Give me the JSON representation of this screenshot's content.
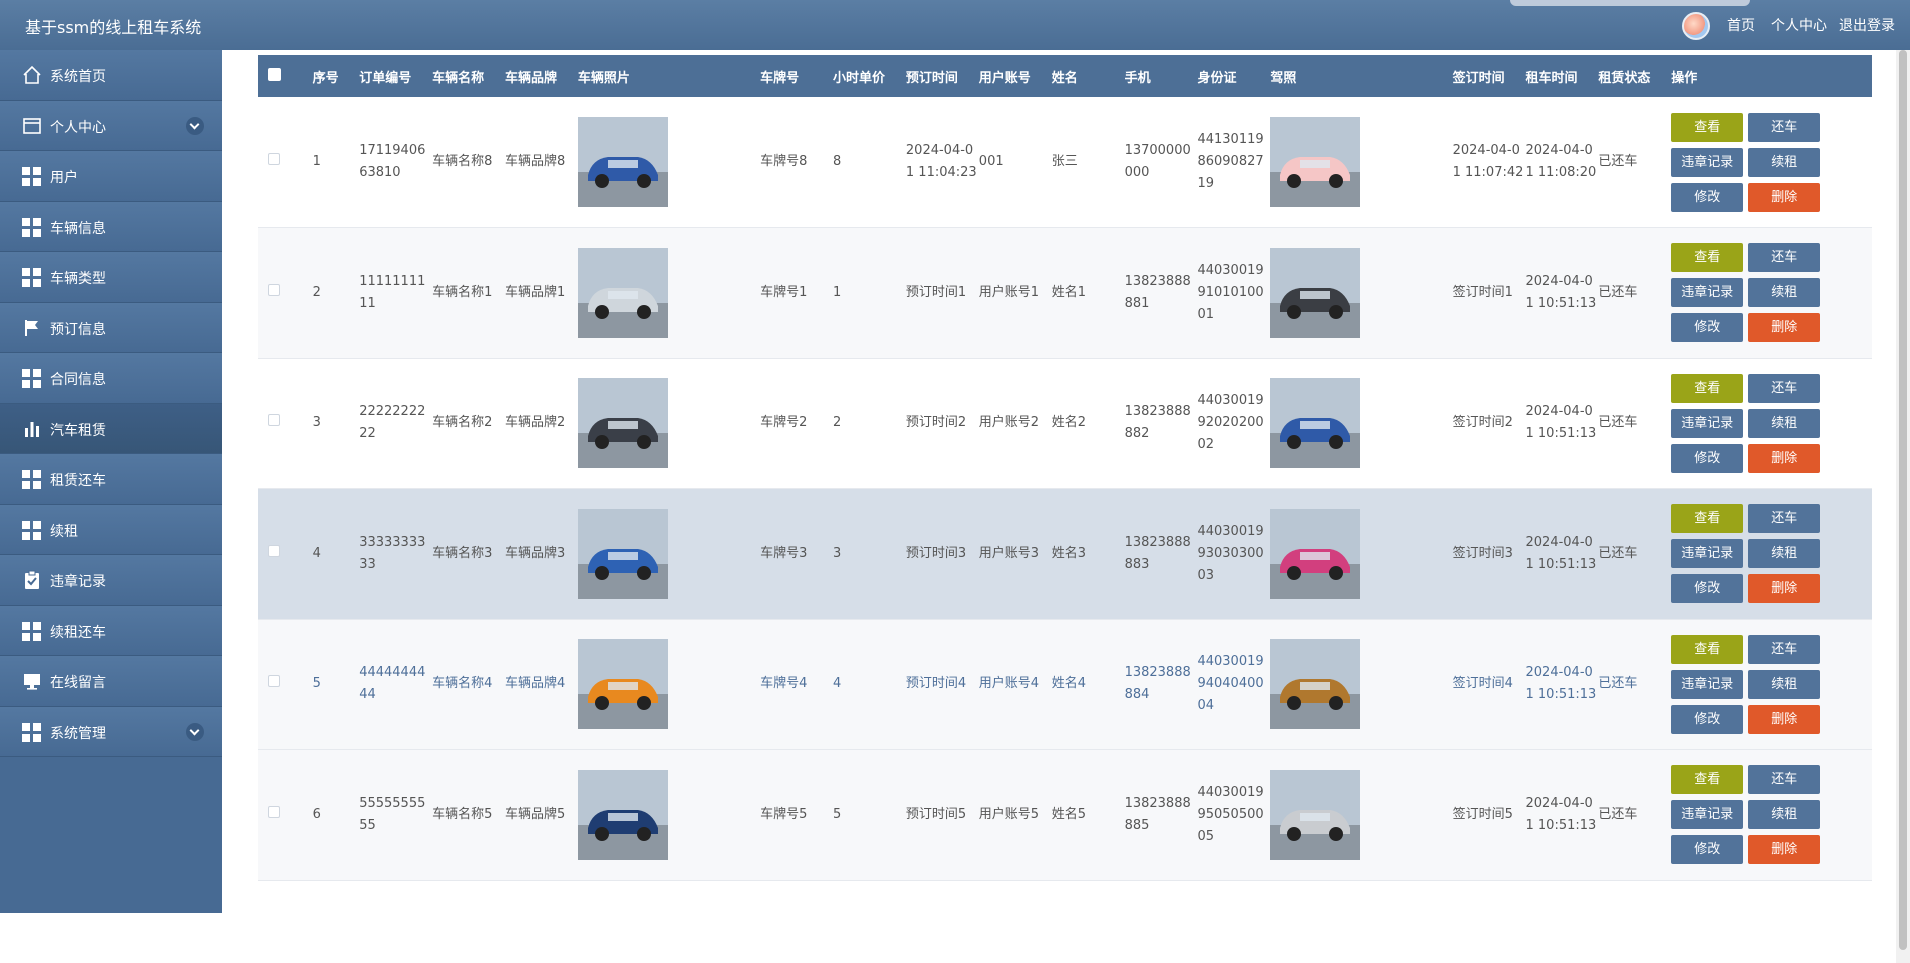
{
  "header": {
    "title": "基于ssm的线上租车系统",
    "nav": [
      "首页",
      "个人中心",
      "退出登录"
    ]
  },
  "sidebar": {
    "items": [
      {
        "label": "系统首页",
        "icon": "home-icon"
      },
      {
        "label": "个人中心",
        "icon": "window-icon",
        "expandable": true
      },
      {
        "label": "用户",
        "icon": "grid-icon"
      },
      {
        "label": "车辆信息",
        "icon": "grid-icon"
      },
      {
        "label": "车辆类型",
        "icon": "grid-icon"
      },
      {
        "label": "预订信息",
        "icon": "flag-icon"
      },
      {
        "label": "合同信息",
        "icon": "grid-icon"
      },
      {
        "label": "汽车租赁",
        "icon": "bar-chart-icon",
        "active": true
      },
      {
        "label": "租赁还车",
        "icon": "grid-icon"
      },
      {
        "label": "续租",
        "icon": "grid-icon"
      },
      {
        "label": "违章记录",
        "icon": "clipboard-check-icon"
      },
      {
        "label": "续租还车",
        "icon": "grid-icon"
      },
      {
        "label": "在线留言",
        "icon": "monitor-icon"
      },
      {
        "label": "系统管理",
        "icon": "grid-icon",
        "expandable": true
      }
    ]
  },
  "table": {
    "columns": [
      "序号",
      "订单编号",
      "车辆名称",
      "车辆品牌",
      "车辆照片",
      "车牌号",
      "小时单价",
      "预订时间",
      "用户账号",
      "姓名",
      "手机",
      "身份证",
      "驾照",
      "签订时间",
      "租车时间",
      "租赁状态",
      "操作"
    ],
    "actions": {
      "view": "查看",
      "return": "还车",
      "violation": "违章记录",
      "renew": "续租",
      "edit": "修改",
      "delete": "删除"
    },
    "rows": [
      {
        "no": "1",
        "order": "1711940663810",
        "name": "车辆名称8",
        "brand": "车辆品牌8",
        "plate": "车牌号8",
        "price": "8",
        "book_time": "2024-04-01 11:04:23",
        "account": "001",
        "person": "张三",
        "phone": "13700000000",
        "id_card": "441301198609082719",
        "sign_time": "2024-04-01 11:07:42",
        "rent_time": "2024-04-01 11:08:20",
        "status": "已还车",
        "car_color": "#2f5aa8",
        "lic_color": "#f5c6c6"
      },
      {
        "no": "2",
        "order": "1111111111",
        "name": "车辆名称1",
        "brand": "车辆品牌1",
        "plate": "车牌号1",
        "price": "1",
        "book_time": "预订时间1",
        "account": "用户账号1",
        "person": "姓名1",
        "phone": "13823888881",
        "id_card": "440300199101010001",
        "sign_time": "签订时间1",
        "rent_time": "2024-04-01 10:51:13",
        "status": "已还车",
        "car_color": "#cfd6dc",
        "lic_color": "#3b3e44"
      },
      {
        "no": "3",
        "order": "2222222222",
        "name": "车辆名称2",
        "brand": "车辆品牌2",
        "plate": "车牌号2",
        "price": "2",
        "book_time": "预订时间2",
        "account": "用户账号2",
        "person": "姓名2",
        "phone": "13823888882",
        "id_card": "440300199202020002",
        "sign_time": "签订时间2",
        "rent_time": "2024-04-01 10:51:13",
        "status": "已还车",
        "car_color": "#3a3f48",
        "lic_color": "#2f5aa8"
      },
      {
        "no": "4",
        "order": "3333333333",
        "name": "车辆名称3",
        "brand": "车辆品牌3",
        "plate": "车牌号3",
        "price": "3",
        "book_time": "预订时间3",
        "account": "用户账号3",
        "person": "姓名3",
        "phone": "13823888883",
        "id_card": "440300199303030003",
        "sign_time": "签订时间3",
        "rent_time": "2024-04-01 10:51:13",
        "status": "已还车",
        "car_color": "#2e62b4",
        "lic_color": "#d23f7e"
      },
      {
        "no": "5",
        "order": "4444444444",
        "name": "车辆名称4",
        "brand": "车辆品牌4",
        "plate": "车牌号4",
        "price": "4",
        "book_time": "预订时间4",
        "account": "用户账号4",
        "person": "姓名4",
        "phone": "13823888884",
        "id_card": "440300199404040004",
        "sign_time": "签订时间4",
        "rent_time": "2024-04-01 10:51:13",
        "status": "已还车",
        "car_color": "#e8891f",
        "lic_color": "#b0782e"
      },
      {
        "no": "6",
        "order": "5555555555",
        "name": "车辆名称5",
        "brand": "车辆品牌5",
        "plate": "车牌号5",
        "price": "5",
        "book_time": "预订时间5",
        "account": "用户账号5",
        "person": "姓名5",
        "phone": "13823888885",
        "id_card": "440300199505050005",
        "sign_time": "签订时间5",
        "rent_time": "2024-04-01 10:51:13",
        "status": "已还车",
        "car_color": "#1f3d72",
        "lic_color": "#c9ccd0"
      }
    ]
  },
  "colors": {
    "header": "#4d6f96",
    "sidebar": "#476a93",
    "view_button": "#9aa418",
    "delete_button": "#e0592a",
    "primary_button": "#52739a"
  }
}
